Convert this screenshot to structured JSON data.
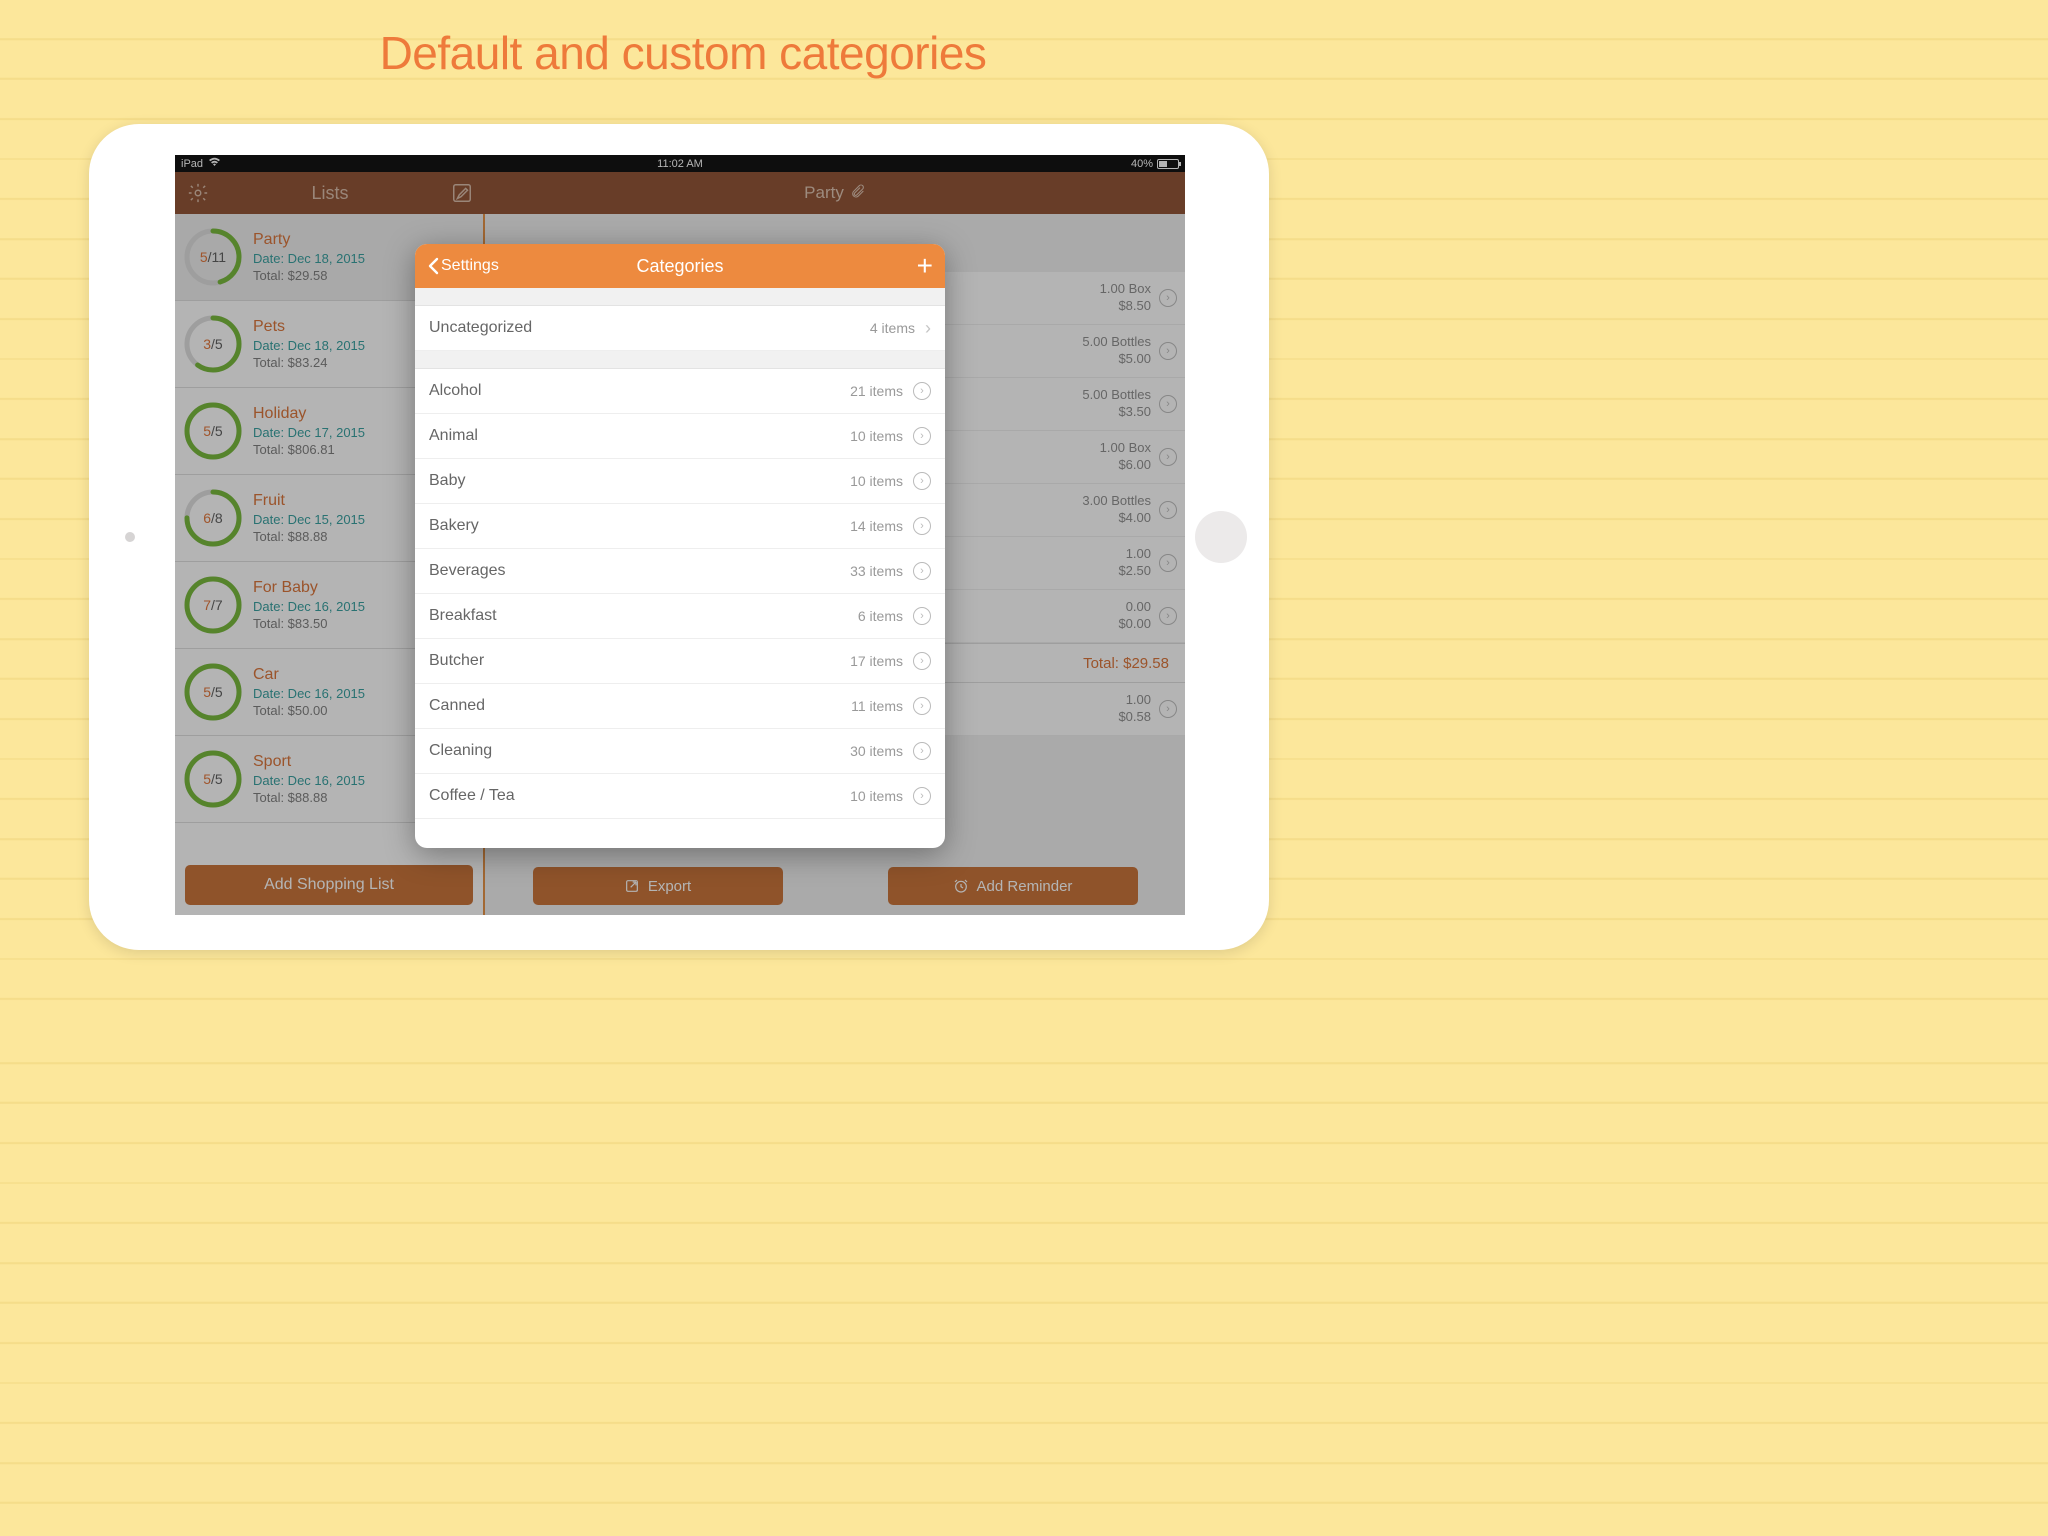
{
  "marketing": {
    "title": "Default and custom categories"
  },
  "status": {
    "device": "iPad",
    "time": "11:02 AM",
    "battery": "40%"
  },
  "nav": {
    "lists_title": "Lists",
    "detail_title": "Party"
  },
  "sidebar": {
    "lists": [
      {
        "name": "Party",
        "done": 5,
        "total": 11,
        "date": "Date: Dec 18, 2015",
        "total_label": "Total: $29.58",
        "selected": true
      },
      {
        "name": "Pets",
        "done": 3,
        "total": 5,
        "date": "Date: Dec 18, 2015",
        "total_label": "Total: $83.24",
        "selected": false
      },
      {
        "name": "Holiday",
        "done": 5,
        "total": 5,
        "date": "Date: Dec 17, 2015",
        "total_label": "Total: $806.81",
        "selected": false
      },
      {
        "name": "Fruit",
        "done": 6,
        "total": 8,
        "date": "Date: Dec 15, 2015",
        "total_label": "Total: $88.88",
        "selected": false
      },
      {
        "name": "For Baby",
        "done": 7,
        "total": 7,
        "date": "Date: Dec 16, 2015",
        "total_label": "Total: $83.50",
        "selected": false
      },
      {
        "name": "Car",
        "done": 5,
        "total": 5,
        "date": "Date: Dec 16, 2015",
        "total_label": "Total: $50.00",
        "selected": false
      },
      {
        "name": "Sport",
        "done": 5,
        "total": 5,
        "date": "Date: Dec 16, 2015",
        "total_label": "Total: $88.88",
        "selected": false
      }
    ],
    "add_button": "Add Shopping List"
  },
  "detail": {
    "items": [
      {
        "qty": "1.00 Box",
        "price": "$8.50"
      },
      {
        "qty": "5.00 Bottles",
        "price": "$5.00"
      },
      {
        "qty": "5.00 Bottles",
        "price": "$3.50"
      },
      {
        "qty": "1.00 Box",
        "price": "$6.00"
      },
      {
        "qty": "3.00 Bottles",
        "price": "$4.00"
      },
      {
        "qty": "1.00",
        "price": "$2.50"
      },
      {
        "qty": "0.00",
        "price": "$0.00"
      }
    ],
    "total_label": "Total: $29.58",
    "extra_item": {
      "qty": "1.00",
      "price": "$0.58"
    },
    "export_button": "Export",
    "reminder_button": "Add Reminder"
  },
  "popover": {
    "back_label": "Settings",
    "title": "Categories",
    "top_row": {
      "name": "Uncategorized",
      "count": "4 items"
    },
    "categories": [
      {
        "name": "Alcohol",
        "count": "21 items"
      },
      {
        "name": "Animal",
        "count": "10 items"
      },
      {
        "name": "Baby",
        "count": "10 items"
      },
      {
        "name": "Bakery",
        "count": "14 items"
      },
      {
        "name": "Beverages",
        "count": "33 items"
      },
      {
        "name": "Breakfast",
        "count": "6 items"
      },
      {
        "name": "Butcher",
        "count": "17 items"
      },
      {
        "name": "Canned",
        "count": "11 items"
      },
      {
        "name": "Cleaning",
        "count": "30 items"
      },
      {
        "name": "Coffee / Tea",
        "count": "10 items"
      }
    ]
  }
}
